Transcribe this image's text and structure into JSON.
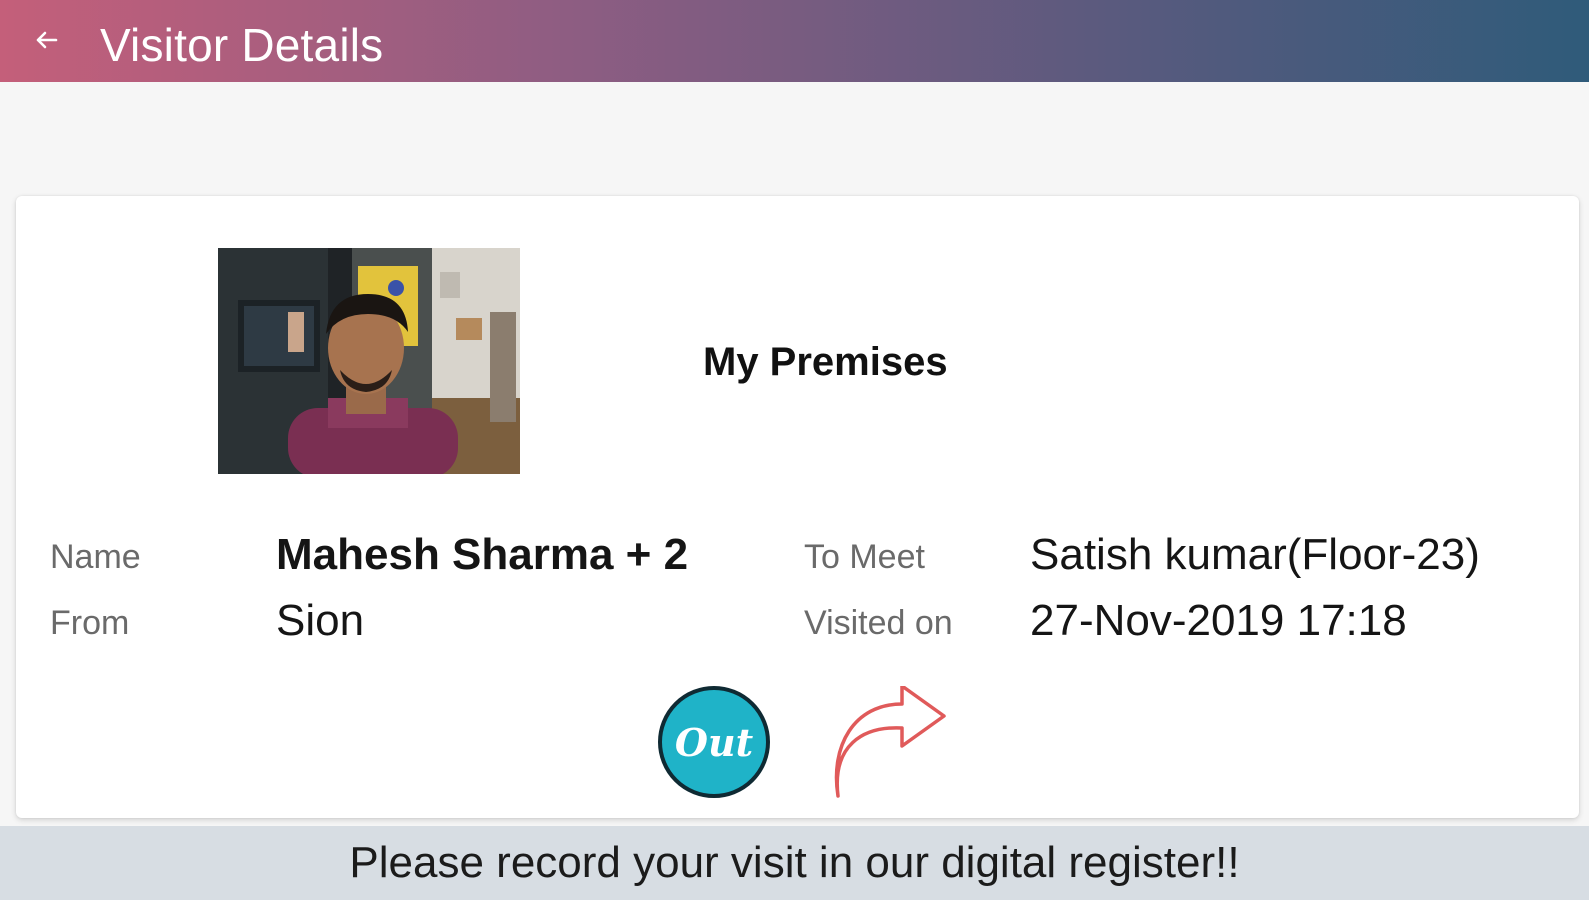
{
  "header": {
    "title": "Visitor Details",
    "back_icon": "arrow-left-icon"
  },
  "card": {
    "premises_name": "My Premises",
    "photo_icon": "visitor-photo",
    "fields": {
      "name_label": "Name",
      "name_value": "Mahesh Sharma + 2",
      "from_label": "From",
      "from_value": "Sion",
      "to_meet_label": "To Meet",
      "to_meet_value": "Satish kumar(Floor-23)",
      "visited_on_label": "Visited on",
      "visited_on_value": "27-Nov-2019 17:18"
    },
    "actions": {
      "out_label": "Out",
      "share_icon": "share-arrow-icon"
    }
  },
  "footer": {
    "message": "Please record your visit in our digital register!!"
  },
  "colors": {
    "header_gradient_start": "#c45f7a",
    "header_gradient_end": "#2f5b7a",
    "out_button": "#1fb3c8",
    "share_arrow": "#e05a5a",
    "footer_bg": "#d7dde3"
  }
}
